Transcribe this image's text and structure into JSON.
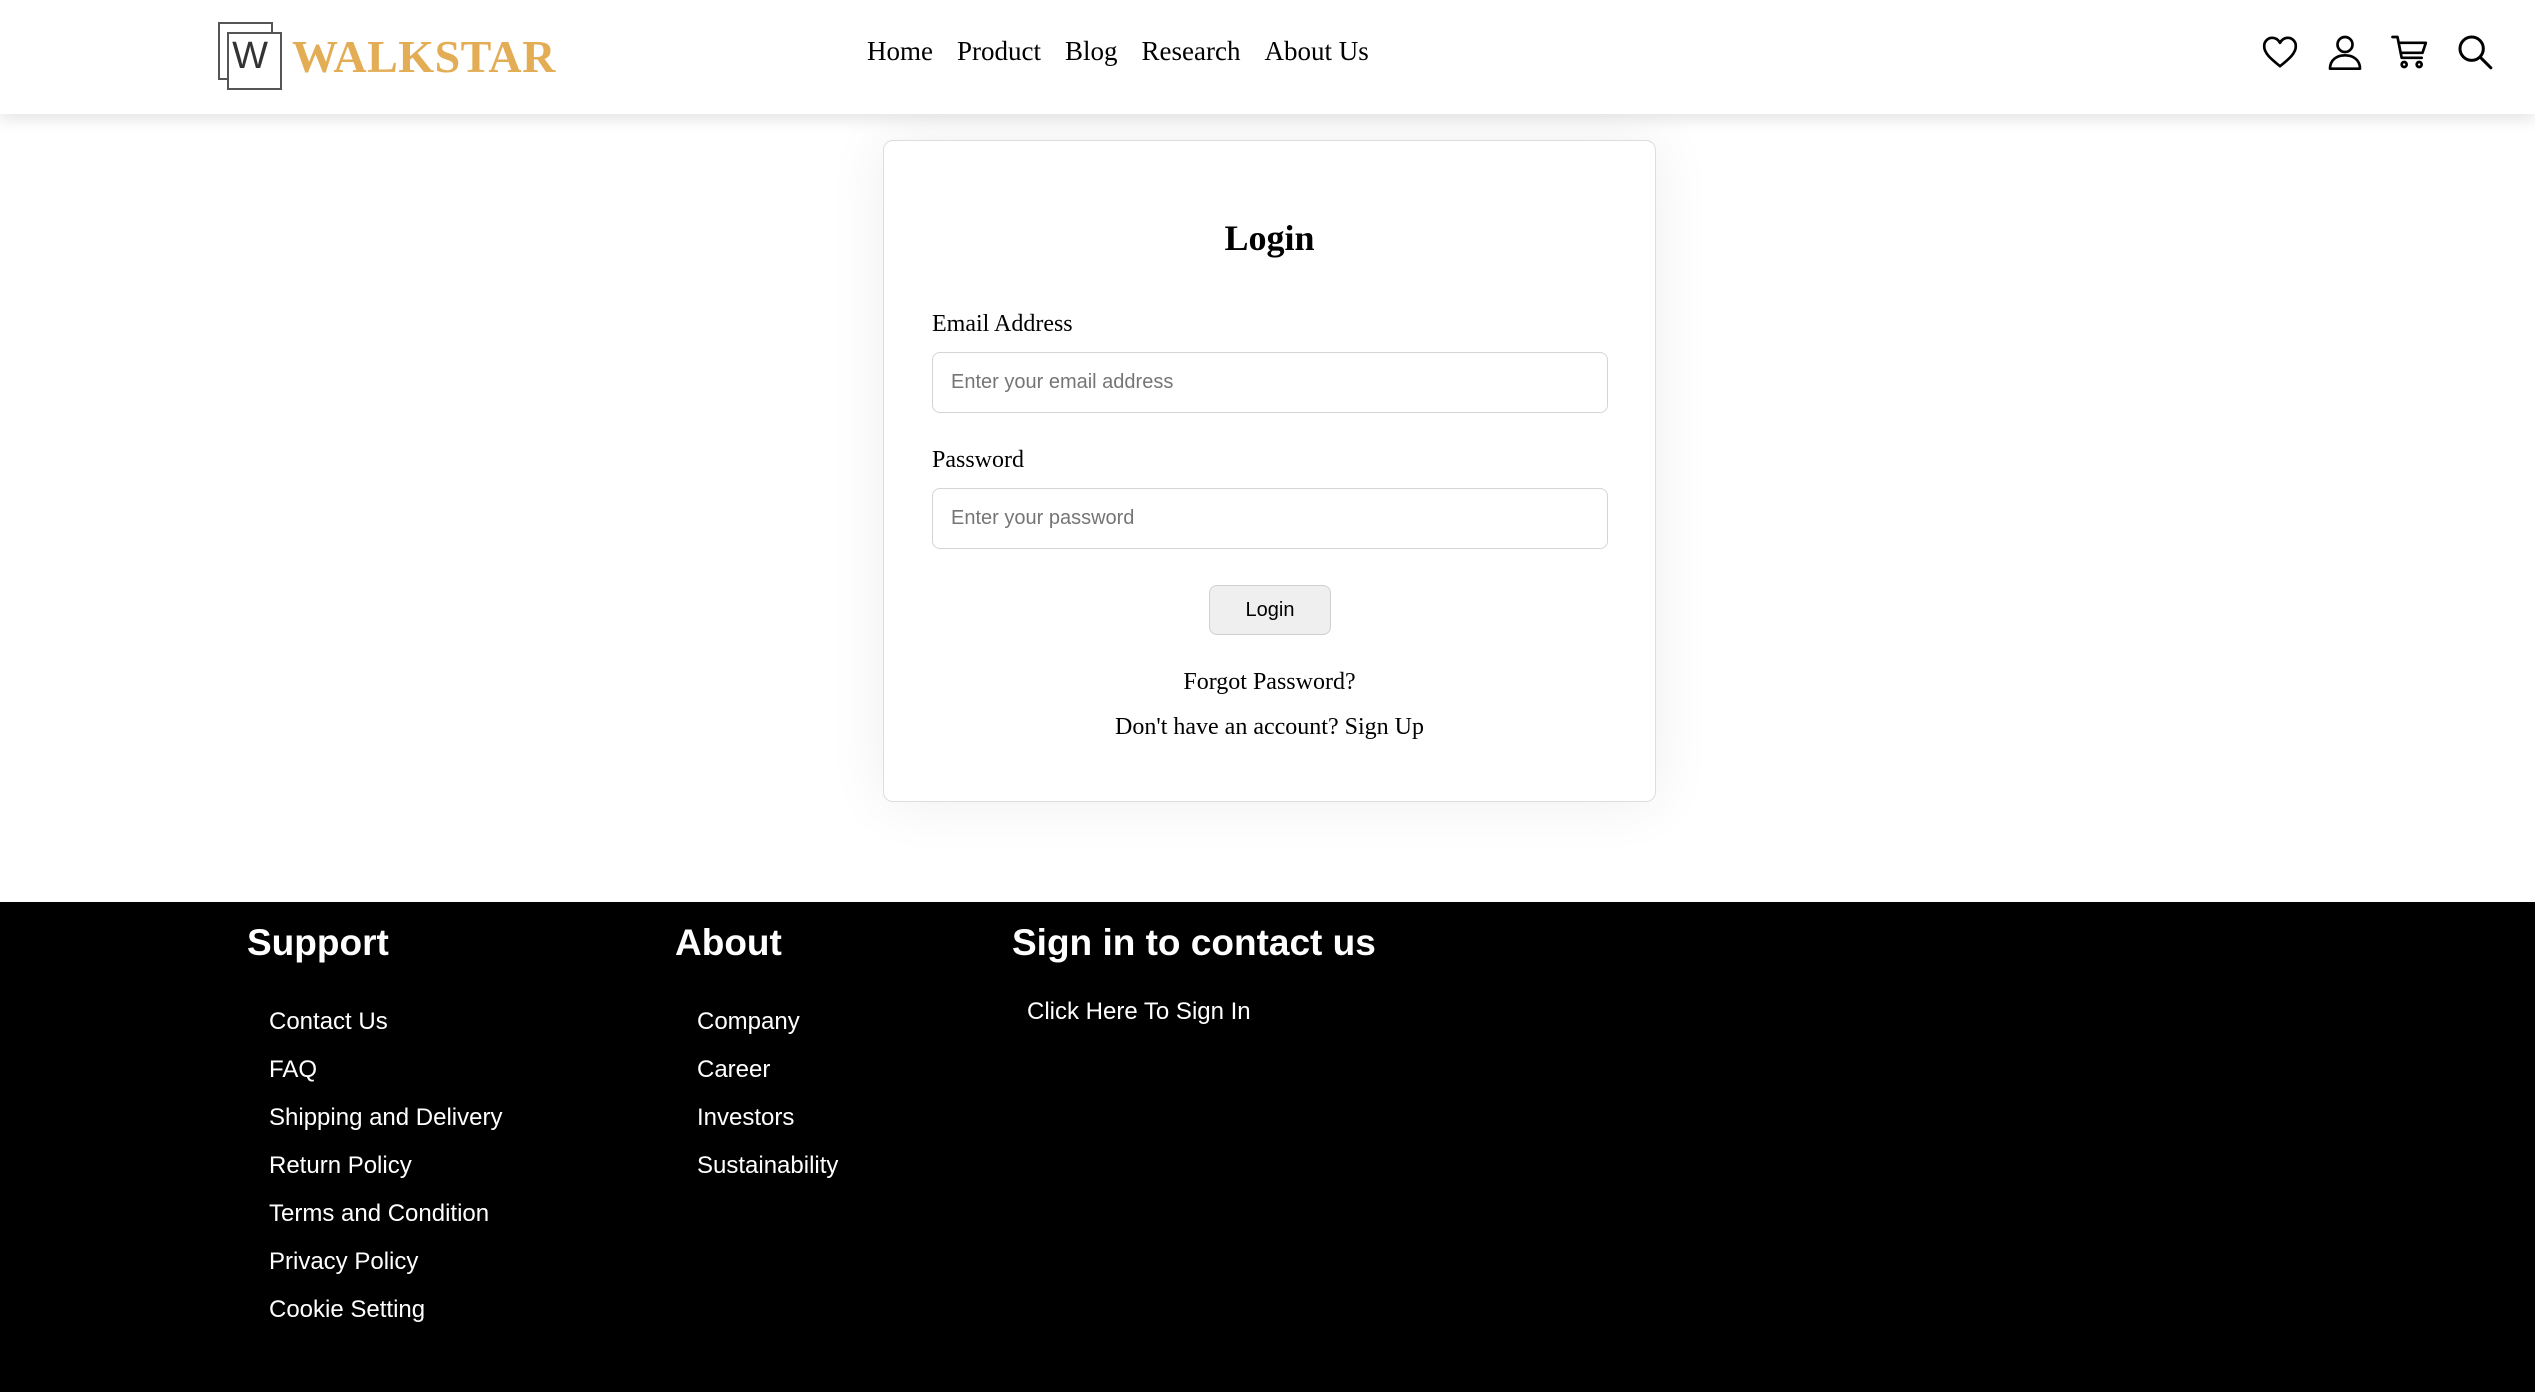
{
  "header": {
    "logo_letter": "W",
    "logo_text": "WALKSTAR",
    "brand_color": "#e2ad55",
    "nav": [
      "Home",
      "Product",
      "Blog",
      "Research",
      "About Us"
    ],
    "icons": [
      "heart-icon",
      "user-icon",
      "cart-icon",
      "search-icon"
    ]
  },
  "login": {
    "title": "Login",
    "email_label": "Email Address",
    "email_placeholder": "Enter your email address",
    "password_label": "Password",
    "password_placeholder": "Enter your password",
    "button_label": "Login",
    "forgot_label": "Forgot Password?",
    "signup_prompt": "Don't have an account?",
    "signup_label": "Sign Up"
  },
  "footer": {
    "support": {
      "title": "Support",
      "links": [
        "Contact Us",
        "FAQ",
        "Shipping and Delivery",
        "Return Policy",
        "Terms and Condition",
        "Privacy Policy",
        "Cookie Setting"
      ]
    },
    "about": {
      "title": "About",
      "links": [
        "Company",
        "Career",
        "Investors",
        "Sustainability"
      ]
    },
    "contact": {
      "title": "Sign in to contact us",
      "link": "Click Here To Sign In"
    }
  }
}
